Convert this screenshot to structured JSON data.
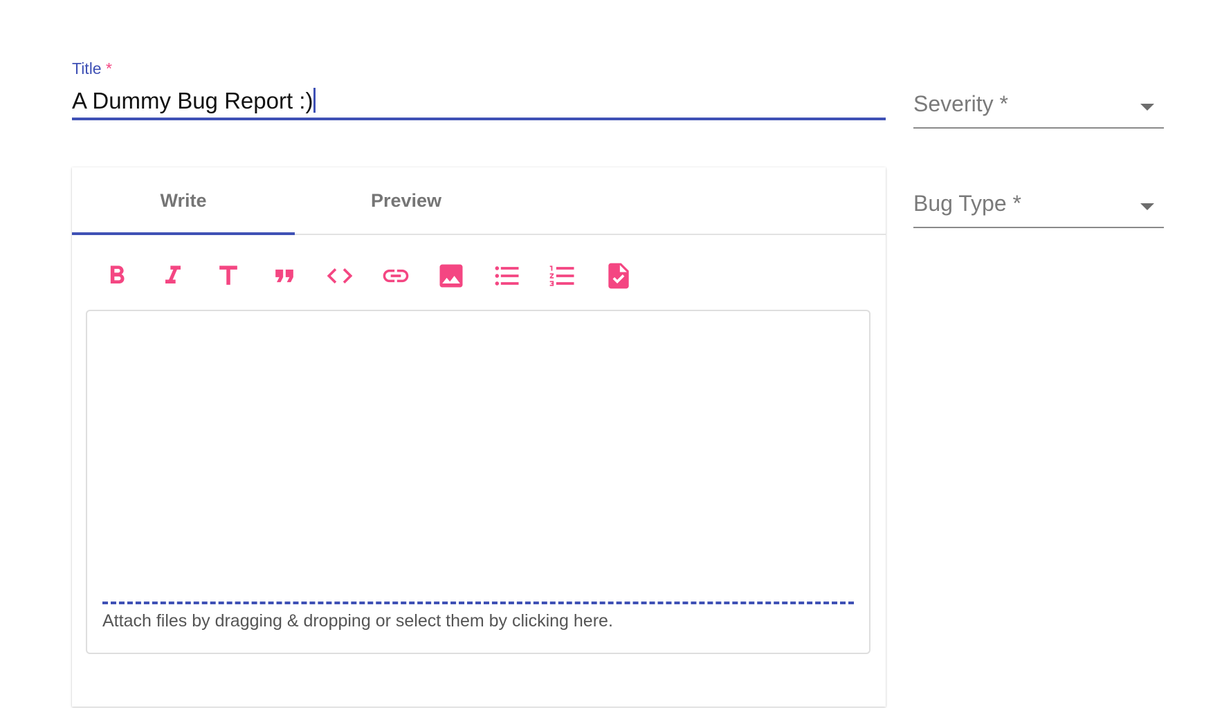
{
  "title_field": {
    "label": "Title",
    "required_mark": "*",
    "value": "A Dummy Bug Report :)"
  },
  "severity_field": {
    "label": "Severity *"
  },
  "bug_type_field": {
    "label": "Bug Type *"
  },
  "editor": {
    "tabs": [
      {
        "label": "Write",
        "active": true
      },
      {
        "label": "Preview",
        "active": false
      }
    ],
    "toolbar": [
      {
        "icon": "bold-icon"
      },
      {
        "icon": "italic-icon"
      },
      {
        "icon": "header-icon"
      },
      {
        "icon": "quote-icon"
      },
      {
        "icon": "code-icon"
      },
      {
        "icon": "link-icon"
      },
      {
        "icon": "image-icon"
      },
      {
        "icon": "unordered-list-icon"
      },
      {
        "icon": "ordered-list-icon"
      },
      {
        "icon": "checked-list-icon"
      }
    ],
    "attach_text": "Attach files by dragging & dropping or select them by clicking here."
  },
  "colors": {
    "primary": "#3f51b5",
    "accent": "#f44682"
  }
}
